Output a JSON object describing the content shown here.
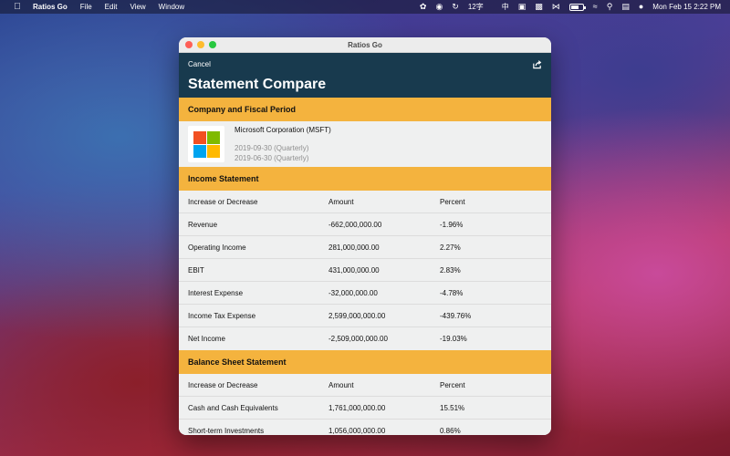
{
  "menubar": {
    "app_name": "Ratios Go",
    "menus": [
      "File",
      "Edit",
      "View",
      "Window"
    ],
    "input_method": "12字",
    "ime_char": "中",
    "datetime": "Mon Feb 15  2:22 PM"
  },
  "window": {
    "title": "Ratios Go",
    "cancel_label": "Cancel",
    "page_title": "Statement Compare"
  },
  "company_section": {
    "header": "Company and Fiscal Period",
    "company_name": "Microsoft Corporation (MSFT)",
    "period_1": "2019-09-30 (Quarterly)",
    "period_2": "2019-06-30 (Quarterly)",
    "logo_colors": [
      "#f25022",
      "#7fba00",
      "#00a4ef",
      "#ffb900"
    ]
  },
  "income_statement": {
    "header": "Income Statement",
    "columns": [
      "Increase or Decrease",
      "Amount",
      "Percent"
    ],
    "rows": [
      {
        "label": "Revenue",
        "amount": "-662,000,000.00",
        "percent": "-1.96%"
      },
      {
        "label": "Operating Income",
        "amount": "281,000,000.00",
        "percent": "2.27%"
      },
      {
        "label": "EBIT",
        "amount": "431,000,000.00",
        "percent": "2.83%"
      },
      {
        "label": "Interest Expense",
        "amount": "-32,000,000.00",
        "percent": "-4.78%"
      },
      {
        "label": "Income Tax Expense",
        "amount": "2,599,000,000.00",
        "percent": "-439.76%"
      },
      {
        "label": "Net Income",
        "amount": "-2,509,000,000.00",
        "percent": "-19.03%"
      }
    ]
  },
  "balance_sheet": {
    "header": "Balance Sheet Statement",
    "columns": [
      "Increase or Decrease",
      "Amount",
      "Percent"
    ],
    "rows": [
      {
        "label": "Cash and Cash Equivalents",
        "amount": "1,761,000,000.00",
        "percent": "15.51%"
      },
      {
        "label": "Short-term Investments",
        "amount": "1,056,000,000.00",
        "percent": "0.86%"
      }
    ]
  },
  "colors": {
    "navbar": "#183a4e",
    "section_header": "#f4b33e",
    "row_background": "#eff0f0"
  }
}
